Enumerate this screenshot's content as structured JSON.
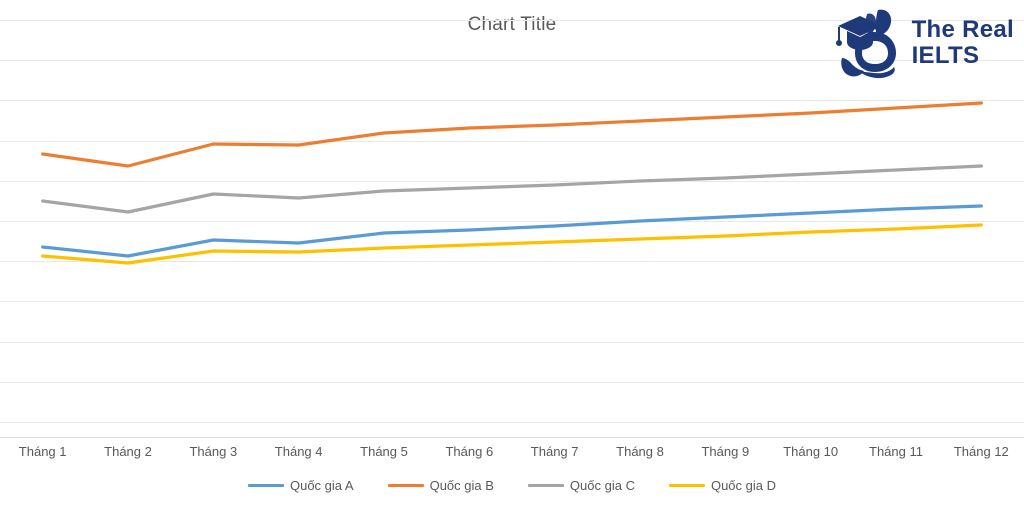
{
  "chart_data": {
    "type": "line",
    "title": "Chart Title",
    "xlabel": "",
    "ylabel": "",
    "grid": true,
    "legend_position": "bottom",
    "axis_labels_visible": false,
    "note": "Y axis tick labels are not visible in the cropped view; only horizontal gridlines are shown.",
    "categories": [
      "Tháng 1",
      "Tháng 2",
      "Tháng 3",
      "Tháng 4",
      "Tháng 5",
      "Tháng 6",
      "Tháng 7",
      "Tháng 8",
      "Tháng 9",
      "Tháng 10",
      "Tháng 11",
      "Tháng 12"
    ],
    "categories_truncated_last": "Th",
    "gridline_count": 11,
    "series": [
      {
        "name": "Quốc gia A",
        "color": "#5B9BD5",
        "values": [
          247,
          256,
          240,
          243,
          233,
          230,
          226,
          221,
          217,
          213,
          209,
          206
        ],
        "units": "pixel-y (lower = higher value)"
      },
      {
        "name": "Quốc gia B",
        "color": "#ED7D31",
        "values": [
          154,
          166,
          144,
          145,
          133,
          128,
          125,
          121,
          117,
          113,
          108,
          103
        ]
      },
      {
        "name": "Quốc gia C",
        "color": "#A5A5A5",
        "values": [
          201,
          212,
          194,
          198,
          191,
          188,
          185,
          181,
          178,
          174,
          170,
          166
        ]
      },
      {
        "name": "Quốc gia D",
        "color": "#FFC000",
        "values": [
          256,
          263,
          251,
          252,
          248,
          245,
          242,
          239,
          236,
          232,
          229,
          225
        ]
      }
    ]
  },
  "logo": {
    "line1": "The Real",
    "line2": "IELTS",
    "color": "#1F3A7A",
    "mark": "graduation-cap-rabbit"
  },
  "colors": {
    "gridline": "#E8E8E8",
    "axis": "#D9D9D9",
    "text": "#595959",
    "background": "#FFFFFF"
  }
}
